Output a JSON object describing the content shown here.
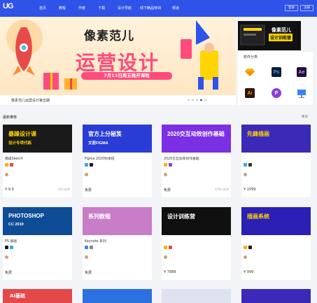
{
  "header": {
    "logo": "UG",
    "nav": [
      "首页",
      "教程",
      "作者",
      "下载",
      "设计导航",
      "线下精品特训",
      "频道"
    ],
    "login": "登录",
    "register": "注册"
  },
  "banner": {
    "title": "像素范儿",
    "subtitle": "运营设计",
    "date": "7月13日周五晚开课啦",
    "caption": "像素范儿运营设计第五期"
  },
  "promo": {
    "line1": "像素范儿",
    "line2": "设计训练营"
  },
  "soft_panel": {
    "title": "软件分类",
    "items": [
      {
        "label": "",
        "icon": "sketch-icon"
      },
      {
        "label": "Ps",
        "icon": "photoshop-icon"
      },
      {
        "label": "Ae",
        "icon": "after-effects-icon"
      },
      {
        "label": "Ai",
        "icon": "illustrator-icon"
      },
      {
        "label": "P",
        "icon": "principle-icon"
      },
      {
        "label": "",
        "icon": "keynote-icon"
      }
    ]
  },
  "section": {
    "title": "最新推荐",
    "more": "更多"
  },
  "cards": [
    {
      "thumb_text": "暴躁设计课",
      "thumb_sub": "设计专项代练",
      "title": "暴躁Sketch",
      "author": "",
      "price": "¥ 9.9",
      "count": "24人在学",
      "bg": "#1a1a1a",
      "fg": "#ffd400"
    },
    {
      "thumb_text": "官方上分秘笈",
      "thumb_sub": "文若FIGMA",
      "title": "Figma 2020秋季班",
      "author": "",
      "price": "免费",
      "count": "",
      "bg": "#2a3cd6",
      "fg": "#ffffff"
    },
    {
      "thumb_text": "2020交互动效创作基础",
      "thumb_sub": "",
      "title": "2020交互动效创作基础",
      "author": "",
      "price": "免费",
      "count": "176人在学",
      "bg": "#7d2fe3",
      "fg": "#ffffff"
    },
    {
      "thumb_text": "先鋒插画",
      "thumb_sub": "",
      "title": "",
      "author": "",
      "price": "¥ 1099",
      "count": "",
      "bg": "#3b2ab8",
      "fg": "#ffd400"
    },
    {
      "thumb_text": "PHOTOSHOP",
      "thumb_sub": "CC 2019",
      "title": "PS 基础",
      "author": "",
      "price": "免费",
      "count": "",
      "bg": "#0f4c96",
      "fg": "#ffffff"
    },
    {
      "thumb_text": "系列教程",
      "thumb_sub": "",
      "title": "Keynote 系列",
      "author": "",
      "price": "免费",
      "count": "",
      "bg": "#c87dc8",
      "fg": "#ffffff"
    },
    {
      "thumb_text": "设计训练营",
      "thumb_sub": "",
      "title": "",
      "author": "",
      "price": "¥ 7888",
      "count": "",
      "bg": "#101010",
      "fg": "#ffffff"
    },
    {
      "thumb_text": "插画系统",
      "thumb_sub": "",
      "title": "",
      "author": "",
      "price": "¥ 999",
      "count": "",
      "bg": "#2b1fb5",
      "fg": "#ffd400"
    }
  ],
  "bottom_cards": [
    {
      "text": "AI基础",
      "bg": "#e44848"
    },
    {
      "text": "",
      "bg": "#2d70e0"
    },
    {
      "text": "",
      "bg": "#dfe2f0"
    },
    {
      "text": "",
      "bg": "#3b2ab8"
    }
  ]
}
